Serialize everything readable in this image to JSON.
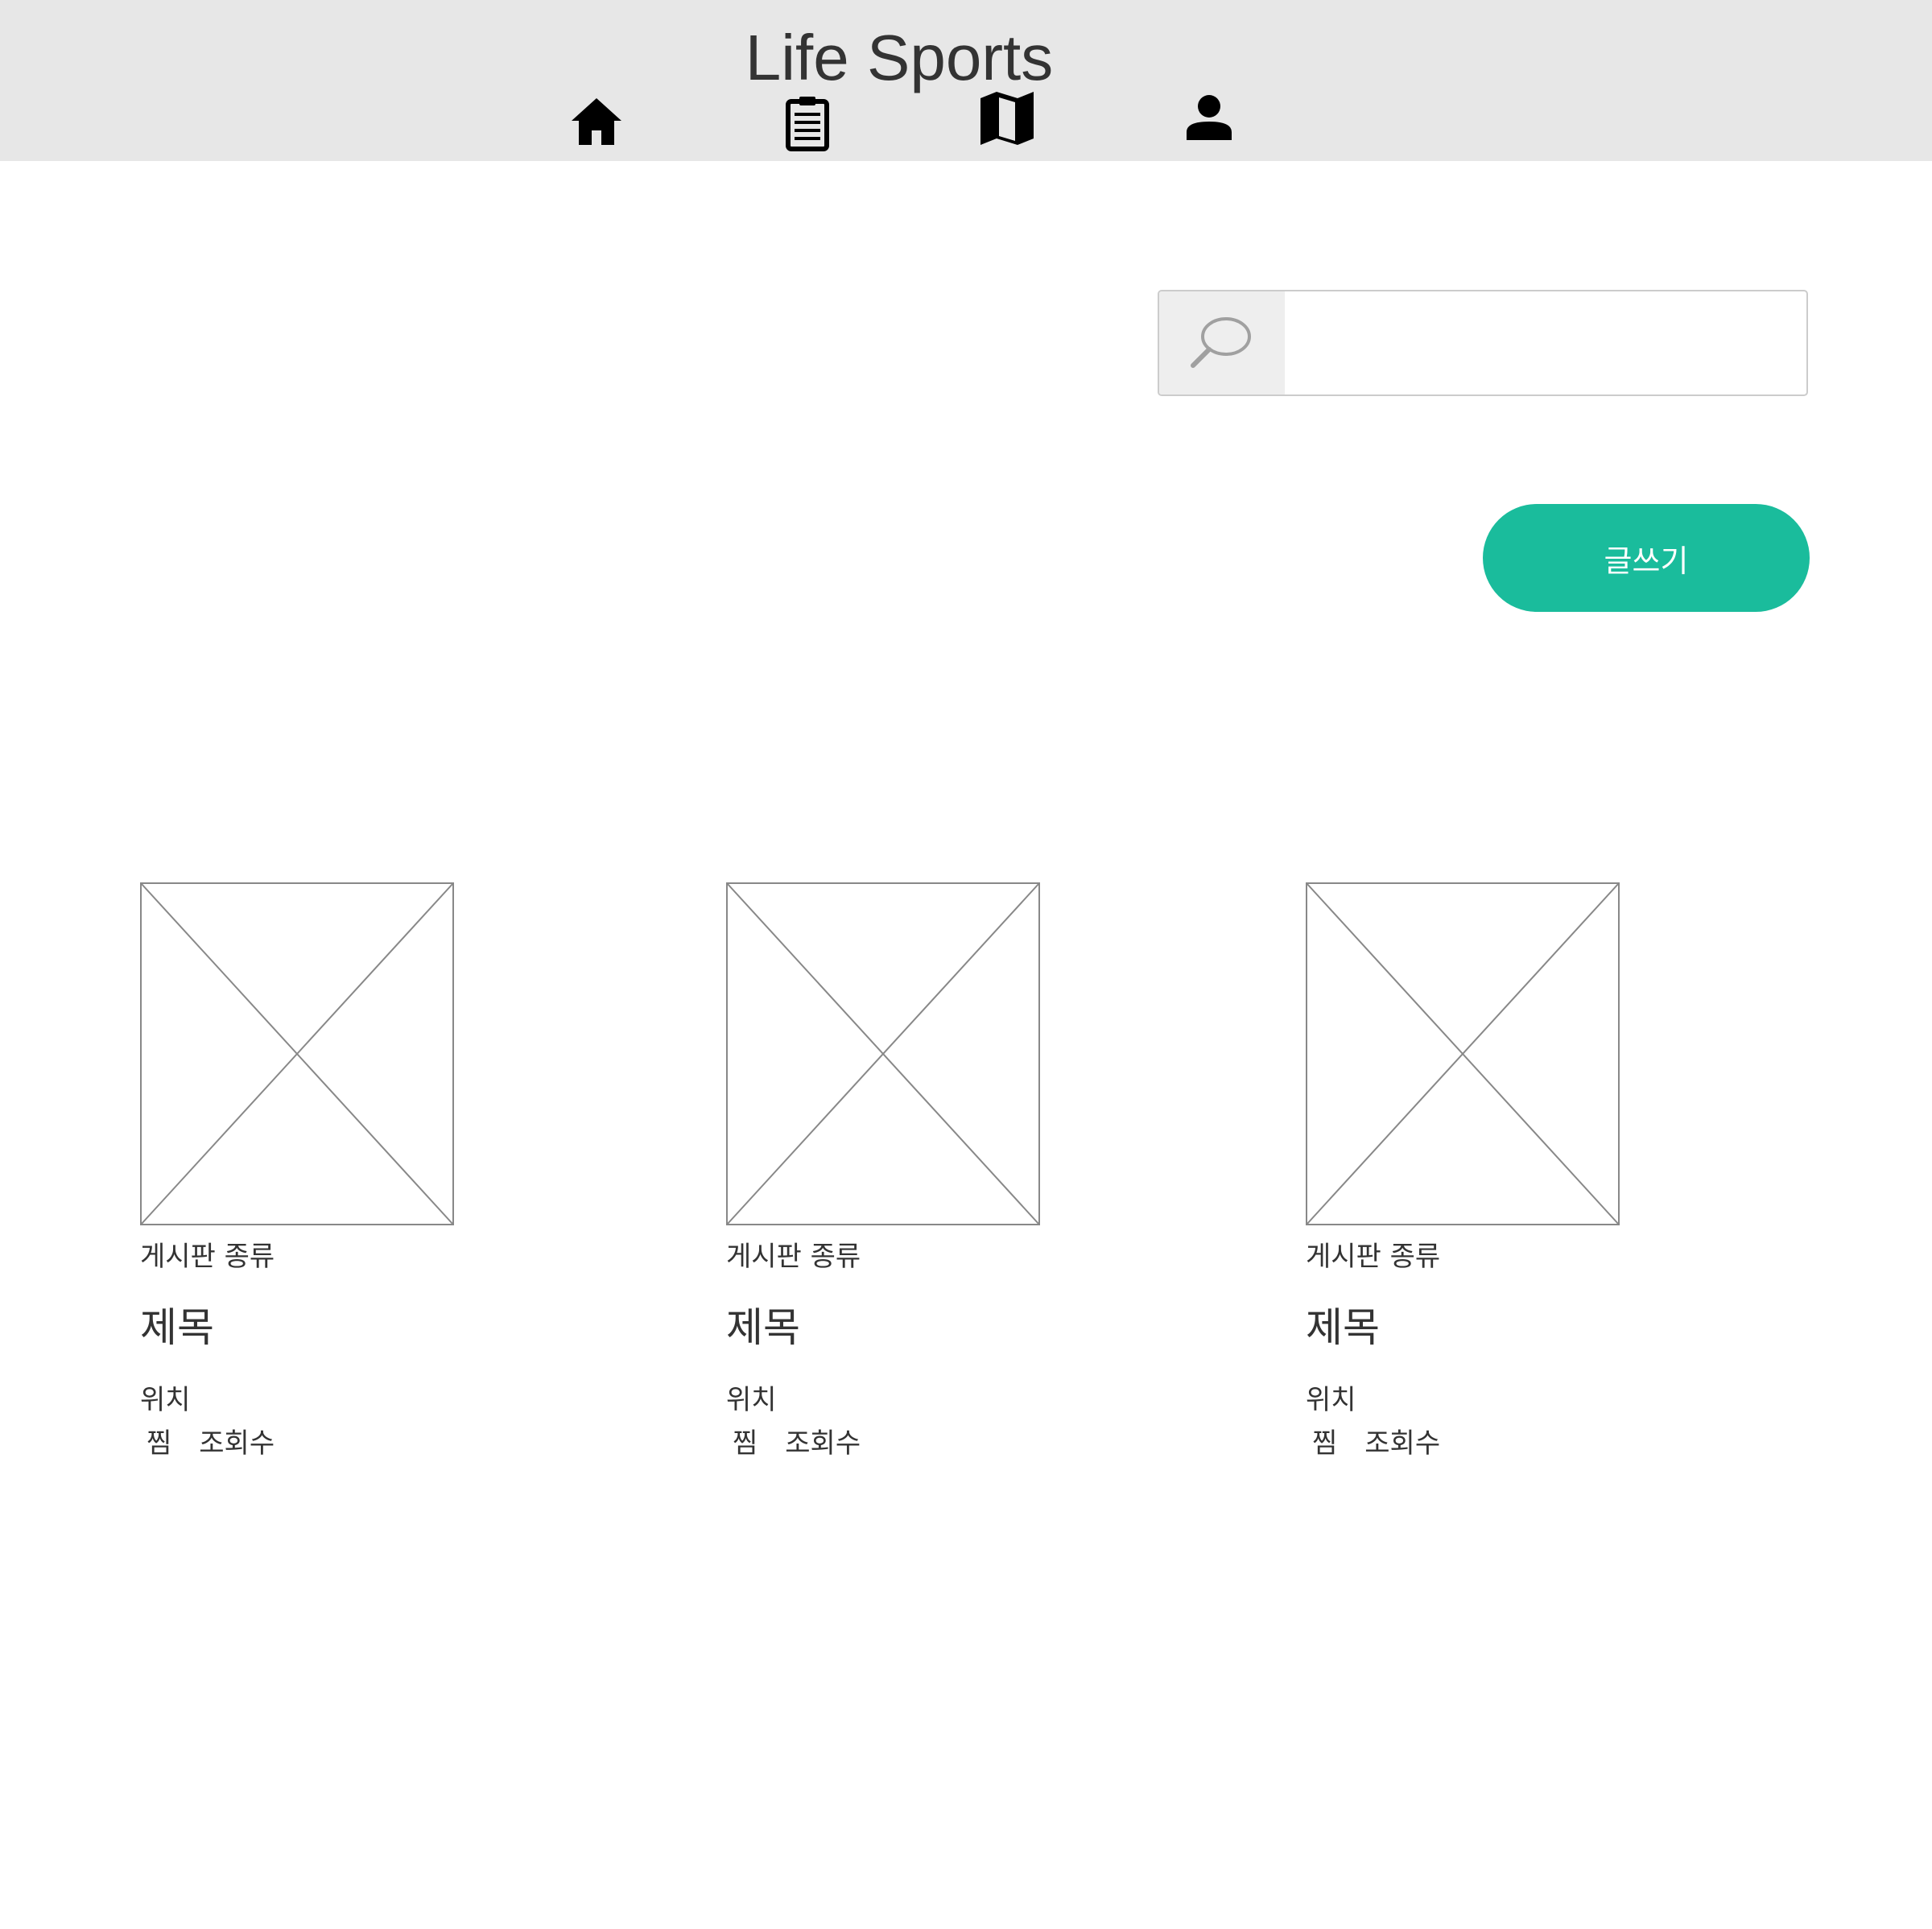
{
  "header": {
    "title": "Life Sports",
    "nav": [
      {
        "icon": "home-icon"
      },
      {
        "icon": "clipboard-icon"
      },
      {
        "icon": "map-icon"
      },
      {
        "icon": "person-icon"
      }
    ]
  },
  "search": {
    "icon": "search-icon",
    "value": "",
    "placeholder": ""
  },
  "write_button": {
    "label": "글쓰기",
    "color": "#1abc9c"
  },
  "cards": [
    {
      "board_type": "게시판 종류",
      "title": "제목",
      "location": "위치",
      "like_label": "찜",
      "views_label": "조회수"
    },
    {
      "board_type": "게시판 종류",
      "title": "제목",
      "location": "위치",
      "like_label": "찜",
      "views_label": "조회수"
    },
    {
      "board_type": "게시판 종류",
      "title": "제목",
      "location": "위치",
      "like_label": "찜",
      "views_label": "조회수"
    }
  ],
  "colors": {
    "header_bg": "#e7e7e7",
    "accent": "#1abc9c",
    "text": "#333333"
  }
}
